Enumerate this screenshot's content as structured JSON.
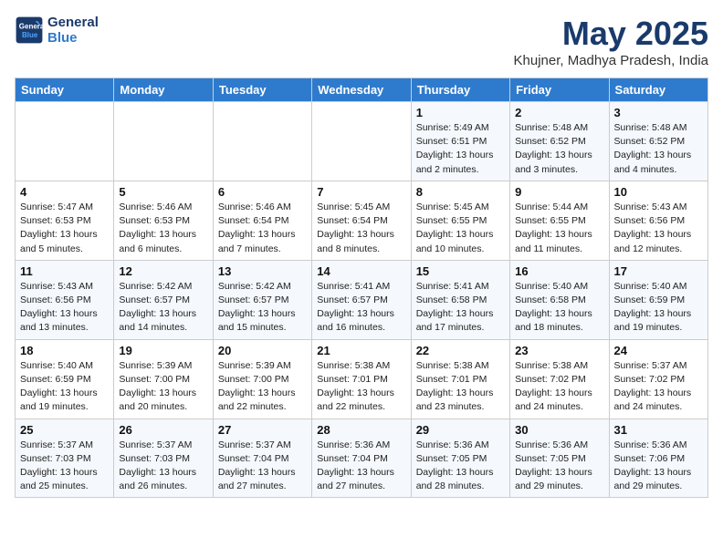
{
  "header": {
    "logo_line1": "General",
    "logo_line2": "Blue",
    "month": "May 2025",
    "location": "Khujner, Madhya Pradesh, India"
  },
  "weekdays": [
    "Sunday",
    "Monday",
    "Tuesday",
    "Wednesday",
    "Thursday",
    "Friday",
    "Saturday"
  ],
  "weeks": [
    [
      {
        "day": "",
        "info": ""
      },
      {
        "day": "",
        "info": ""
      },
      {
        "day": "",
        "info": ""
      },
      {
        "day": "",
        "info": ""
      },
      {
        "day": "1",
        "info": "Sunrise: 5:49 AM\nSunset: 6:51 PM\nDaylight: 13 hours\nand 2 minutes."
      },
      {
        "day": "2",
        "info": "Sunrise: 5:48 AM\nSunset: 6:52 PM\nDaylight: 13 hours\nand 3 minutes."
      },
      {
        "day": "3",
        "info": "Sunrise: 5:48 AM\nSunset: 6:52 PM\nDaylight: 13 hours\nand 4 minutes."
      }
    ],
    [
      {
        "day": "4",
        "info": "Sunrise: 5:47 AM\nSunset: 6:53 PM\nDaylight: 13 hours\nand 5 minutes."
      },
      {
        "day": "5",
        "info": "Sunrise: 5:46 AM\nSunset: 6:53 PM\nDaylight: 13 hours\nand 6 minutes."
      },
      {
        "day": "6",
        "info": "Sunrise: 5:46 AM\nSunset: 6:54 PM\nDaylight: 13 hours\nand 7 minutes."
      },
      {
        "day": "7",
        "info": "Sunrise: 5:45 AM\nSunset: 6:54 PM\nDaylight: 13 hours\nand 8 minutes."
      },
      {
        "day": "8",
        "info": "Sunrise: 5:45 AM\nSunset: 6:55 PM\nDaylight: 13 hours\nand 10 minutes."
      },
      {
        "day": "9",
        "info": "Sunrise: 5:44 AM\nSunset: 6:55 PM\nDaylight: 13 hours\nand 11 minutes."
      },
      {
        "day": "10",
        "info": "Sunrise: 5:43 AM\nSunset: 6:56 PM\nDaylight: 13 hours\nand 12 minutes."
      }
    ],
    [
      {
        "day": "11",
        "info": "Sunrise: 5:43 AM\nSunset: 6:56 PM\nDaylight: 13 hours\nand 13 minutes."
      },
      {
        "day": "12",
        "info": "Sunrise: 5:42 AM\nSunset: 6:57 PM\nDaylight: 13 hours\nand 14 minutes."
      },
      {
        "day": "13",
        "info": "Sunrise: 5:42 AM\nSunset: 6:57 PM\nDaylight: 13 hours\nand 15 minutes."
      },
      {
        "day": "14",
        "info": "Sunrise: 5:41 AM\nSunset: 6:57 PM\nDaylight: 13 hours\nand 16 minutes."
      },
      {
        "day": "15",
        "info": "Sunrise: 5:41 AM\nSunset: 6:58 PM\nDaylight: 13 hours\nand 17 minutes."
      },
      {
        "day": "16",
        "info": "Sunrise: 5:40 AM\nSunset: 6:58 PM\nDaylight: 13 hours\nand 18 minutes."
      },
      {
        "day": "17",
        "info": "Sunrise: 5:40 AM\nSunset: 6:59 PM\nDaylight: 13 hours\nand 19 minutes."
      }
    ],
    [
      {
        "day": "18",
        "info": "Sunrise: 5:40 AM\nSunset: 6:59 PM\nDaylight: 13 hours\nand 19 minutes."
      },
      {
        "day": "19",
        "info": "Sunrise: 5:39 AM\nSunset: 7:00 PM\nDaylight: 13 hours\nand 20 minutes."
      },
      {
        "day": "20",
        "info": "Sunrise: 5:39 AM\nSunset: 7:00 PM\nDaylight: 13 hours\nand 22 minutes."
      },
      {
        "day": "21",
        "info": "Sunrise: 5:38 AM\nSunset: 7:01 PM\nDaylight: 13 hours\nand 22 minutes."
      },
      {
        "day": "22",
        "info": "Sunrise: 5:38 AM\nSunset: 7:01 PM\nDaylight: 13 hours\nand 23 minutes."
      },
      {
        "day": "23",
        "info": "Sunrise: 5:38 AM\nSunset: 7:02 PM\nDaylight: 13 hours\nand 24 minutes."
      },
      {
        "day": "24",
        "info": "Sunrise: 5:37 AM\nSunset: 7:02 PM\nDaylight: 13 hours\nand 24 minutes."
      }
    ],
    [
      {
        "day": "25",
        "info": "Sunrise: 5:37 AM\nSunset: 7:03 PM\nDaylight: 13 hours\nand 25 minutes."
      },
      {
        "day": "26",
        "info": "Sunrise: 5:37 AM\nSunset: 7:03 PM\nDaylight: 13 hours\nand 26 minutes."
      },
      {
        "day": "27",
        "info": "Sunrise: 5:37 AM\nSunset: 7:04 PM\nDaylight: 13 hours\nand 27 minutes."
      },
      {
        "day": "28",
        "info": "Sunrise: 5:36 AM\nSunset: 7:04 PM\nDaylight: 13 hours\nand 27 minutes."
      },
      {
        "day": "29",
        "info": "Sunrise: 5:36 AM\nSunset: 7:05 PM\nDaylight: 13 hours\nand 28 minutes."
      },
      {
        "day": "30",
        "info": "Sunrise: 5:36 AM\nSunset: 7:05 PM\nDaylight: 13 hours\nand 29 minutes."
      },
      {
        "day": "31",
        "info": "Sunrise: 5:36 AM\nSunset: 7:06 PM\nDaylight: 13 hours\nand 29 minutes."
      }
    ]
  ]
}
